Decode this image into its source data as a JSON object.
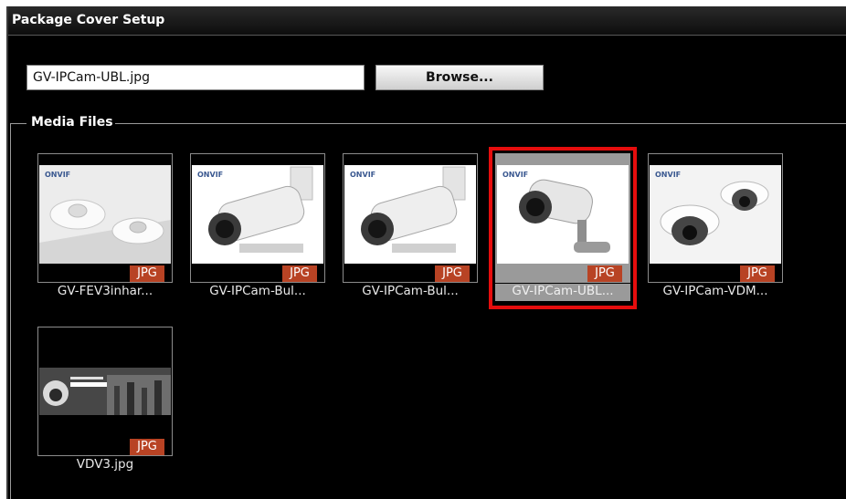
{
  "window": {
    "title": "Package Cover Setup"
  },
  "cover": {
    "file_value": "GV-IPCam-UBL.jpg",
    "browse_label": "Browse..."
  },
  "media": {
    "legend": "Media Files",
    "items": [
      {
        "caption": "GV-FEV3inhar...",
        "badge": "JPG",
        "icon": "fisheye-camera-image",
        "selected": false
      },
      {
        "caption": "GV-IPCam-Bul...",
        "badge": "JPG",
        "icon": "bullet-camera-image",
        "selected": false
      },
      {
        "caption": "GV-IPCam-Bul...",
        "badge": "JPG",
        "icon": "bullet-camera-image",
        "selected": false
      },
      {
        "caption": "GV-IPCam-UBL...",
        "badge": "JPG",
        "icon": "ubl-camera-image",
        "selected": true
      },
      {
        "caption": "GV-IPCam-VDM...",
        "badge": "JPG",
        "icon": "dome-camera-image",
        "selected": false
      },
      {
        "caption": "VDV3.jpg",
        "badge": "JPG",
        "icon": "promo-banner-image",
        "selected": false
      }
    ]
  },
  "colors": {
    "selection": "#e60d0d",
    "badge": "#b84324",
    "brand_logo": "#3a5890"
  },
  "image_text": {
    "onvif_logo": "ONVIF"
  }
}
